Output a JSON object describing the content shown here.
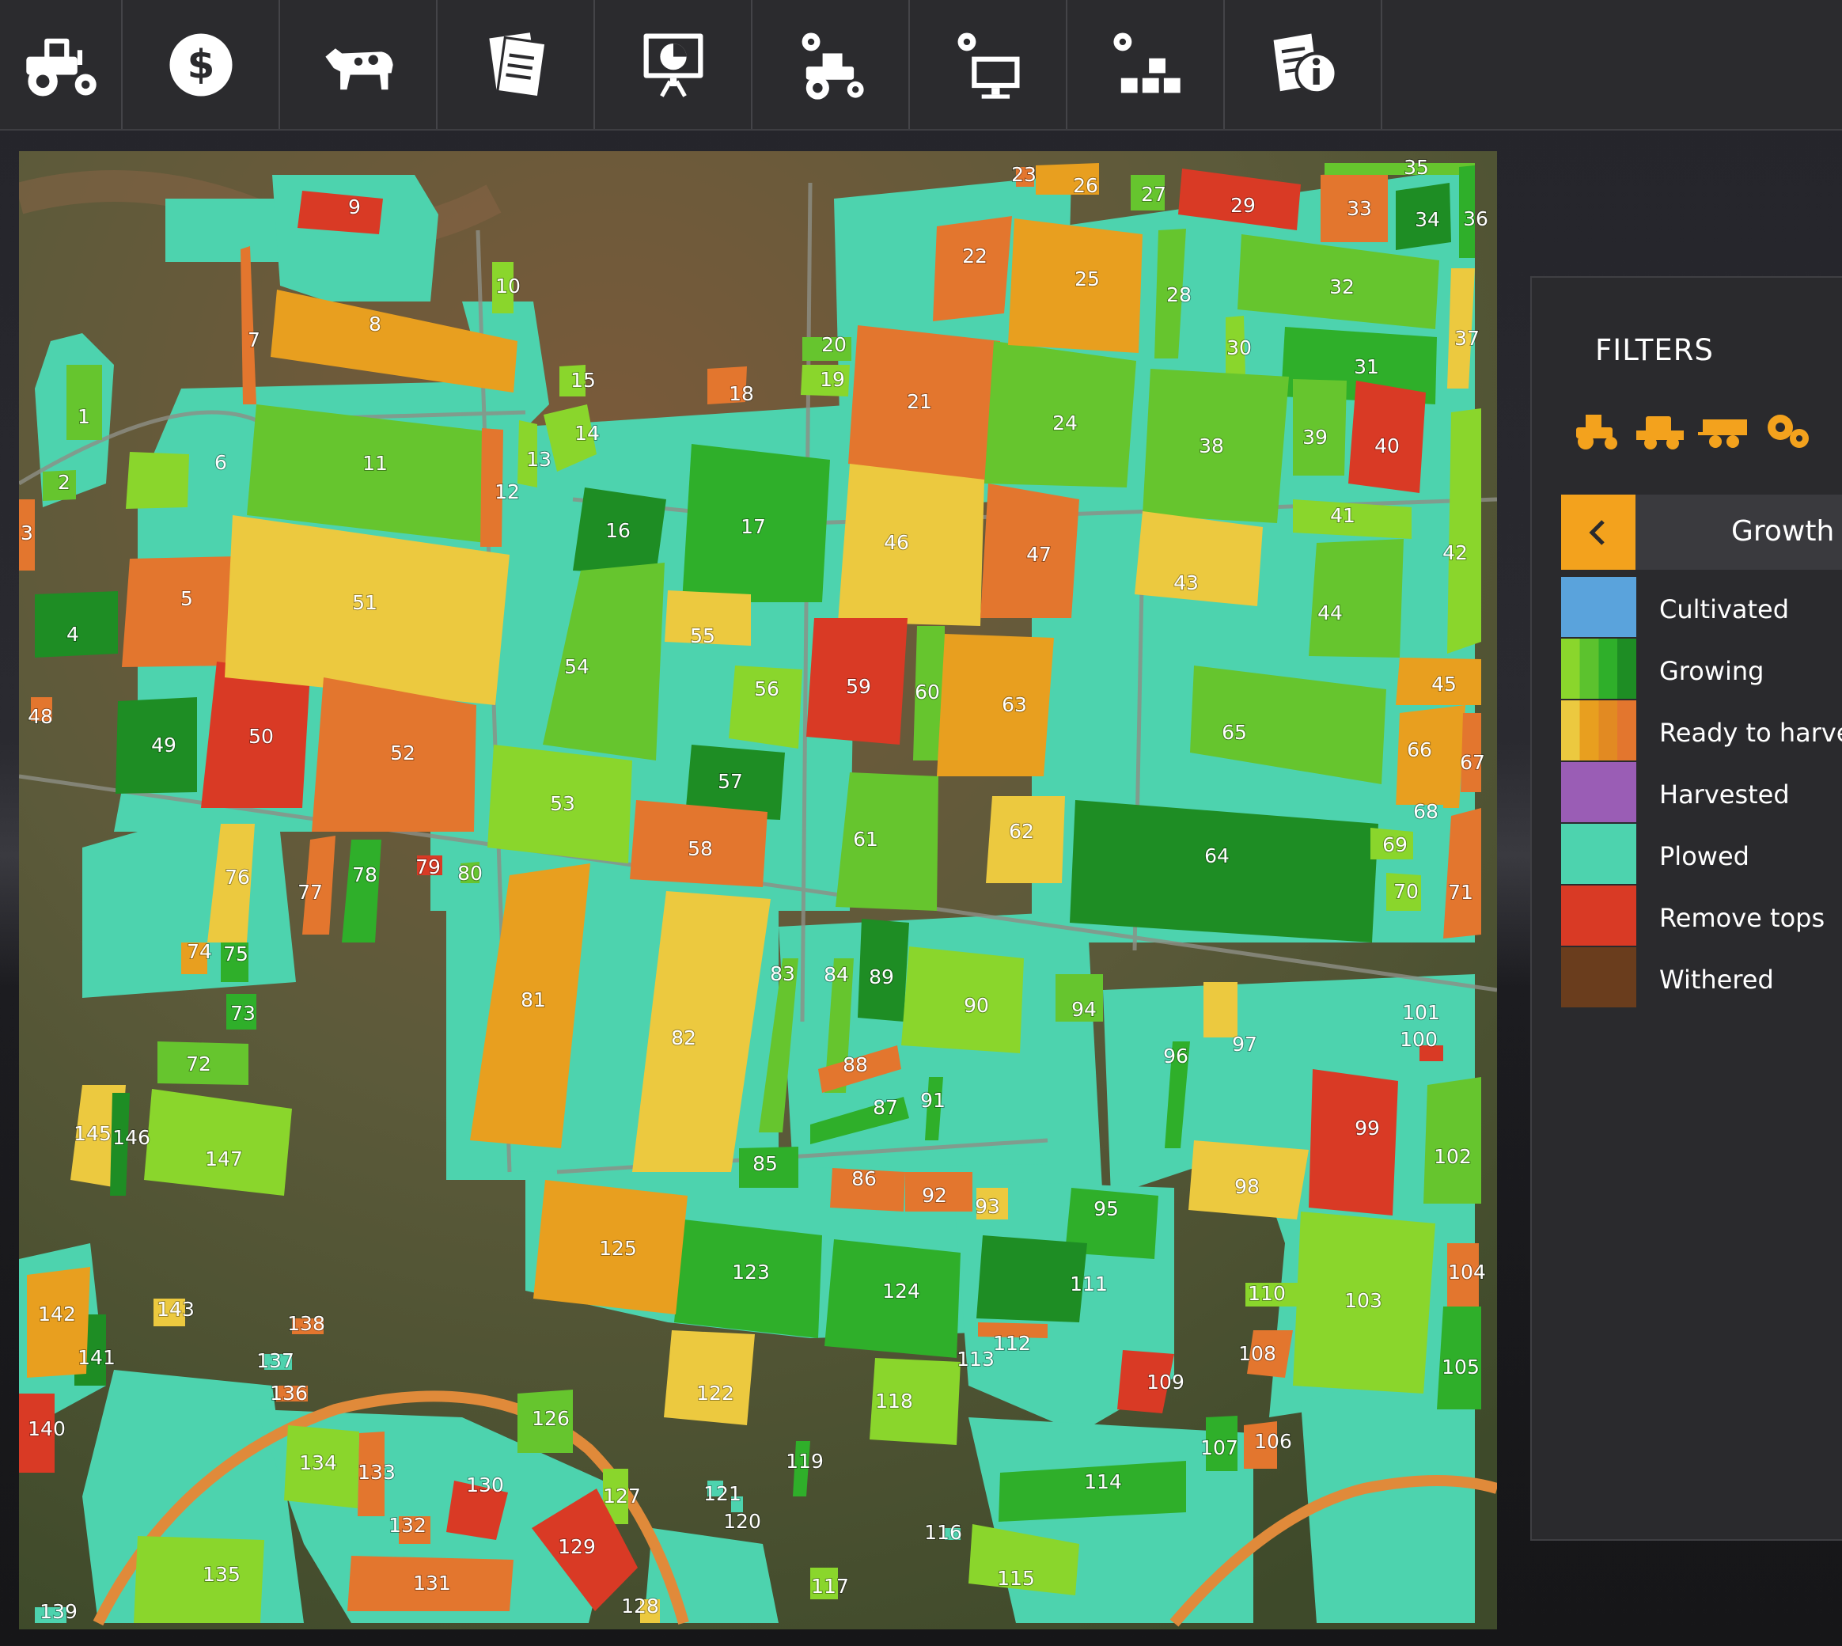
{
  "topbar": {
    "buttons": [
      {
        "name": "vehicles-tab",
        "icon": "tractor-icon"
      },
      {
        "name": "finances-tab",
        "icon": "dollar-icon"
      },
      {
        "name": "animals-tab",
        "icon": "cow-icon"
      },
      {
        "name": "contracts-tab",
        "icon": "documents-icon"
      },
      {
        "name": "statistics-tab",
        "icon": "presentation-icon"
      },
      {
        "name": "vehicle-settings-tab",
        "icon": "tractor-gear-icon"
      },
      {
        "name": "general-settings-tab",
        "icon": "monitor-gear-icon"
      },
      {
        "name": "production-tab",
        "icon": "blocks-gear-icon"
      },
      {
        "name": "help-tab",
        "icon": "info-document-icon"
      }
    ]
  },
  "filters": {
    "title": "FILTERS",
    "category_icons": [
      "tractor-icon",
      "harvester-icon",
      "trailer-icon",
      "gears-icon",
      "more-icon"
    ],
    "growth_title": "Growth",
    "legend": [
      {
        "label": "Cultivated",
        "colors": [
          "#5aa3dc"
        ]
      },
      {
        "label": "Growing",
        "colors": [
          "#8ad62c",
          "#5cc22e",
          "#2faf2a",
          "#1e8d24"
        ]
      },
      {
        "label": "Ready to harvest",
        "colors": [
          "#ecc93f",
          "#e89f1f",
          "#e28a22",
          "#e3762e"
        ]
      },
      {
        "label": "Harvested",
        "colors": [
          "#9a5db5"
        ]
      },
      {
        "label": "Plowed",
        "colors": [
          "#4dd3ae"
        ]
      },
      {
        "label": "Remove tops",
        "colors": [
          "#d93a25"
        ]
      },
      {
        "label": "Withered",
        "colors": [
          "#6a3d1d"
        ]
      }
    ]
  },
  "map": {
    "fields": [
      {
        "id": "1",
        "c": "g2"
      },
      {
        "id": "2",
        "c": "g2"
      },
      {
        "id": "3",
        "c": "o4"
      },
      {
        "id": "4",
        "c": "g4"
      },
      {
        "id": "5",
        "c": "o4"
      },
      {
        "id": "6",
        "c": "g1"
      },
      {
        "id": "7",
        "c": "o4"
      },
      {
        "id": "8",
        "c": "o2"
      },
      {
        "id": "9",
        "c": "r"
      },
      {
        "id": "10",
        "c": "g1"
      },
      {
        "id": "11",
        "c": "g2"
      },
      {
        "id": "12",
        "c": "o4"
      },
      {
        "id": "13",
        "c": "g1"
      },
      {
        "id": "14",
        "c": "g1"
      },
      {
        "id": "15",
        "c": "g1"
      },
      {
        "id": "16",
        "c": "g4"
      },
      {
        "id": "17",
        "c": "g3"
      },
      {
        "id": "18",
        "c": "o4"
      },
      {
        "id": "19",
        "c": "g1"
      },
      {
        "id": "20",
        "c": "g2"
      },
      {
        "id": "21",
        "c": "o4"
      },
      {
        "id": "22",
        "c": "o4"
      },
      {
        "id": "23",
        "c": "o4"
      },
      {
        "id": "24",
        "c": "g2"
      },
      {
        "id": "25",
        "c": "o2"
      },
      {
        "id": "26",
        "c": "o2"
      },
      {
        "id": "27",
        "c": "g2"
      },
      {
        "id": "28",
        "c": "g2"
      },
      {
        "id": "29",
        "c": "r"
      },
      {
        "id": "30",
        "c": "g1"
      },
      {
        "id": "31",
        "c": "g3"
      },
      {
        "id": "32",
        "c": "g2"
      },
      {
        "id": "33",
        "c": "o4"
      },
      {
        "id": "34",
        "c": "g4"
      },
      {
        "id": "35",
        "c": "g2"
      },
      {
        "id": "36",
        "c": "g3"
      },
      {
        "id": "37",
        "c": "o1"
      },
      {
        "id": "38",
        "c": "g2"
      },
      {
        "id": "39",
        "c": "g2"
      },
      {
        "id": "40",
        "c": "r"
      },
      {
        "id": "41",
        "c": "g1"
      },
      {
        "id": "42",
        "c": "g1"
      },
      {
        "id": "43",
        "c": "o1"
      },
      {
        "id": "44",
        "c": "g2"
      },
      {
        "id": "45",
        "c": "o2"
      },
      {
        "id": "46",
        "c": "o1"
      },
      {
        "id": "47",
        "c": "o4"
      },
      {
        "id": "48",
        "c": "o4"
      },
      {
        "id": "49",
        "c": "g4"
      },
      {
        "id": "50",
        "c": "r"
      },
      {
        "id": "51",
        "c": "o1"
      },
      {
        "id": "52",
        "c": "o4"
      },
      {
        "id": "53",
        "c": "g1"
      },
      {
        "id": "54",
        "c": "g2"
      },
      {
        "id": "55",
        "c": "o1"
      },
      {
        "id": "56",
        "c": "g1"
      },
      {
        "id": "57",
        "c": "g4"
      },
      {
        "id": "58",
        "c": "o4"
      },
      {
        "id": "59",
        "c": "r"
      },
      {
        "id": "60",
        "c": "g2"
      },
      {
        "id": "61",
        "c": "g2"
      },
      {
        "id": "62",
        "c": "o1"
      },
      {
        "id": "63",
        "c": "o2"
      },
      {
        "id": "64",
        "c": "g4"
      },
      {
        "id": "65",
        "c": "g2"
      },
      {
        "id": "66",
        "c": "o2"
      },
      {
        "id": "67",
        "c": "o4"
      },
      {
        "id": "68",
        "c": "p"
      },
      {
        "id": "69",
        "c": "g1"
      },
      {
        "id": "70",
        "c": "g1"
      },
      {
        "id": "71",
        "c": "o4"
      },
      {
        "id": "72",
        "c": "g2"
      },
      {
        "id": "73",
        "c": "g3"
      },
      {
        "id": "74",
        "c": "o2"
      },
      {
        "id": "75",
        "c": "g3"
      },
      {
        "id": "76",
        "c": "o1"
      },
      {
        "id": "77",
        "c": "o4"
      },
      {
        "id": "78",
        "c": "g3"
      },
      {
        "id": "79",
        "c": "r"
      },
      {
        "id": "80",
        "c": "g2"
      },
      {
        "id": "81",
        "c": "o2"
      },
      {
        "id": "82",
        "c": "o1"
      },
      {
        "id": "83",
        "c": "g2"
      },
      {
        "id": "84",
        "c": "g2"
      },
      {
        "id": "85",
        "c": "g3"
      },
      {
        "id": "86",
        "c": "o4"
      },
      {
        "id": "87",
        "c": "g3"
      },
      {
        "id": "88",
        "c": "o4"
      },
      {
        "id": "89",
        "c": "g4"
      },
      {
        "id": "90",
        "c": "g1"
      },
      {
        "id": "91",
        "c": "g3"
      },
      {
        "id": "92",
        "c": "o4"
      },
      {
        "id": "93",
        "c": "o1"
      },
      {
        "id": "94",
        "c": "g2"
      },
      {
        "id": "95",
        "c": "g3"
      },
      {
        "id": "96",
        "c": "g3"
      },
      {
        "id": "97",
        "c": "o1"
      },
      {
        "id": "98",
        "c": "o1"
      },
      {
        "id": "99",
        "c": "r"
      },
      {
        "id": "100",
        "c": "r"
      },
      {
        "id": "101",
        "c": "p"
      },
      {
        "id": "102",
        "c": "g2"
      },
      {
        "id": "103",
        "c": "g1"
      },
      {
        "id": "104",
        "c": "o4"
      },
      {
        "id": "105",
        "c": "g3"
      },
      {
        "id": "106",
        "c": "o4"
      },
      {
        "id": "107",
        "c": "g3"
      },
      {
        "id": "108",
        "c": "o4"
      },
      {
        "id": "109",
        "c": "r"
      },
      {
        "id": "110",
        "c": "g1"
      },
      {
        "id": "111",
        "c": "g4"
      },
      {
        "id": "112",
        "c": "o4"
      },
      {
        "id": "113",
        "c": "p"
      },
      {
        "id": "114",
        "c": "g3"
      },
      {
        "id": "115",
        "c": "g1"
      },
      {
        "id": "116",
        "c": "p"
      },
      {
        "id": "117",
        "c": "g1"
      },
      {
        "id": "118",
        "c": "g1"
      },
      {
        "id": "119",
        "c": "g3"
      },
      {
        "id": "120",
        "c": "p"
      },
      {
        "id": "121",
        "c": "p"
      },
      {
        "id": "122",
        "c": "o1"
      },
      {
        "id": "123",
        "c": "g3"
      },
      {
        "id": "124",
        "c": "g3"
      },
      {
        "id": "125",
        "c": "o2"
      },
      {
        "id": "126",
        "c": "g2"
      },
      {
        "id": "127",
        "c": "g1"
      },
      {
        "id": "128",
        "c": "o1"
      },
      {
        "id": "129",
        "c": "r"
      },
      {
        "id": "130",
        "c": "r"
      },
      {
        "id": "131",
        "c": "o4"
      },
      {
        "id": "132",
        "c": "o4"
      },
      {
        "id": "133",
        "c": "o4"
      },
      {
        "id": "134",
        "c": "g1"
      },
      {
        "id": "135",
        "c": "g1"
      },
      {
        "id": "136",
        "c": "o4"
      },
      {
        "id": "137",
        "c": "p"
      },
      {
        "id": "138",
        "c": "o4"
      },
      {
        "id": "139",
        "c": "p"
      },
      {
        "id": "140",
        "c": "r"
      },
      {
        "id": "141",
        "c": "g4"
      },
      {
        "id": "142",
        "c": "o2"
      },
      {
        "id": "143",
        "c": "o1"
      },
      {
        "id": "145",
        "c": "o1"
      },
      {
        "id": "146",
        "c": "g4"
      },
      {
        "id": "147",
        "c": "g1"
      }
    ]
  }
}
